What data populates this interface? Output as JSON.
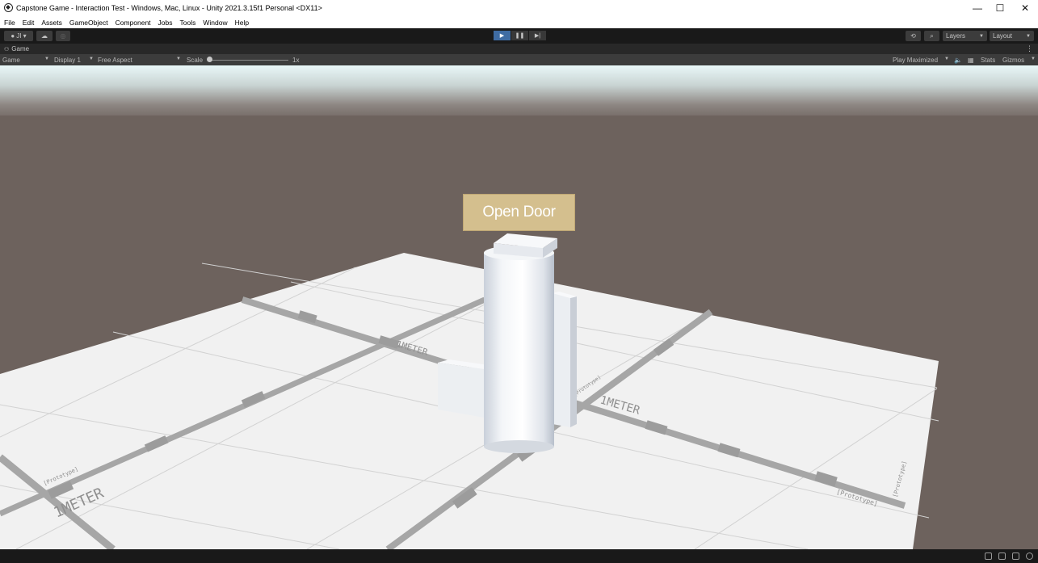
{
  "window": {
    "title": "Capstone Game - Interaction Test - Windows, Mac, Linux - Unity 2021.3.15f1 Personal <DX11>",
    "minimize_glyph": "—",
    "maximize_glyph": "☐",
    "close_glyph": "✕"
  },
  "menu": [
    "File",
    "Edit",
    "Assets",
    "GameObject",
    "Component",
    "Jobs",
    "Tools",
    "Window",
    "Help"
  ],
  "toolbar": {
    "account_label": "JI ▾",
    "play_glyph": "▶",
    "pause_glyph": "❚❚",
    "step_glyph": "▶|",
    "layers_label": "Layers",
    "layout_label": "Layout"
  },
  "game_tab": {
    "label": "Game"
  },
  "game_bar": {
    "mode": "Game",
    "display": "Display 1",
    "aspect": "Free Aspect",
    "scale_label": "Scale",
    "scale_value": "1x",
    "play_mode": "Play Maximized",
    "stats": "Stats",
    "gizmos": "Gizmos"
  },
  "scene": {
    "button_label": "Open Door",
    "floor_labels": [
      "1METER",
      "1METER",
      "1METER",
      "[Prototype]",
      "[Prototype]",
      "[Prototype]",
      "[Prototype]"
    ]
  },
  "colors": {
    "sky_top": "#e8f6f7",
    "ground": "#6d625d",
    "floor": "#f0f0f0",
    "grid_line": "#a8a8a8",
    "button_bg": "#d4bf8e",
    "play_active": "#3f6ca3"
  }
}
